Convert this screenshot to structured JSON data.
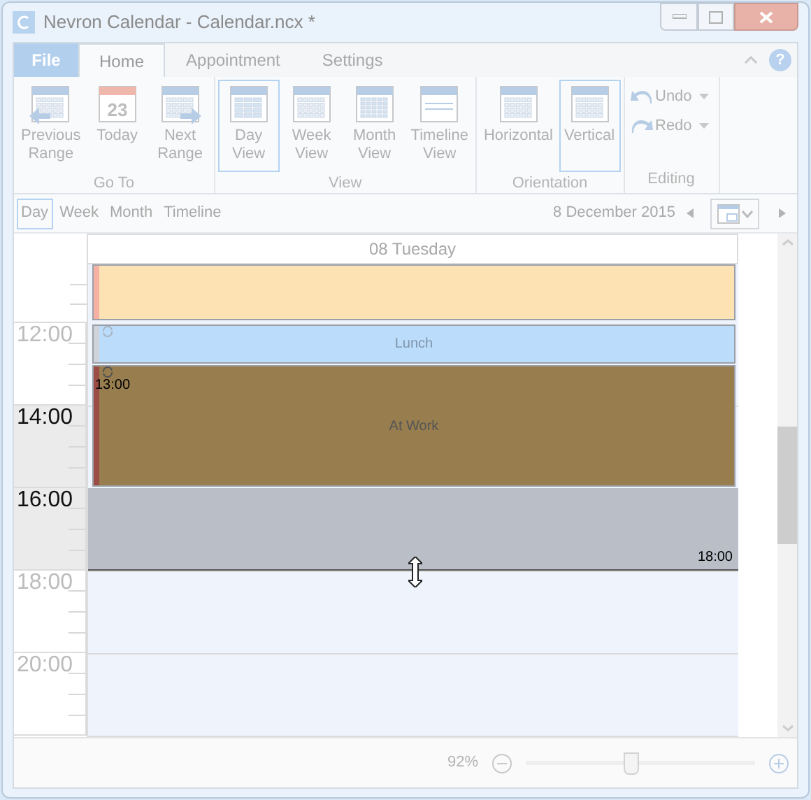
{
  "window": {
    "title": "Nevron Calendar - Calendar.ncx *"
  },
  "ribbon": {
    "file_tab": "File",
    "help": "?",
    "tabs": [
      {
        "label": "Home",
        "selected": true
      },
      {
        "label": "Appointment",
        "selected": false
      },
      {
        "label": "Settings",
        "selected": false
      }
    ],
    "groups": [
      {
        "label": "Go To",
        "buttons": [
          {
            "kind": "previous",
            "lines": [
              "Previous",
              "Range"
            ],
            "selected": false
          },
          {
            "kind": "today",
            "lines": [
              "Today"
            ],
            "day": "23",
            "selected": false
          },
          {
            "kind": "next",
            "lines": [
              "Next",
              "Range"
            ],
            "selected": false
          }
        ]
      },
      {
        "label": "View",
        "buttons": [
          {
            "kind": "day",
            "lines": [
              "Day",
              "View"
            ],
            "selected": true
          },
          {
            "kind": "week",
            "lines": [
              "Week",
              "View"
            ],
            "selected": false
          },
          {
            "kind": "month",
            "lines": [
              "Month",
              "View"
            ],
            "selected": false
          },
          {
            "kind": "timeline",
            "lines": [
              "Timeline",
              "View"
            ],
            "selected": false
          }
        ]
      },
      {
        "label": "Orientation",
        "buttons": [
          {
            "kind": "horizontal",
            "lines": [
              "Horizontal"
            ],
            "selected": false
          },
          {
            "kind": "vertical",
            "lines": [
              "Vertical"
            ],
            "selected": true
          }
        ]
      }
    ],
    "editing": {
      "label": "Editing",
      "buttons": [
        {
          "kind": "undo",
          "label": "Undo"
        },
        {
          "kind": "redo",
          "label": "Redo"
        }
      ]
    }
  },
  "view_bar": {
    "views": [
      {
        "label": "Day",
        "selected": true
      },
      {
        "label": "Week",
        "selected": false
      },
      {
        "label": "Month",
        "selected": false
      },
      {
        "label": "Timeline",
        "selected": false
      }
    ],
    "date": "8 December 2015"
  },
  "calendar": {
    "day_header": "08 Tuesday",
    "hours": [
      {
        "label": "12:00",
        "highlighted": false
      },
      {
        "label": "14:00",
        "highlighted": true
      },
      {
        "label": "16:00",
        "highlighted": true
      },
      {
        "label": "18:00",
        "highlighted": false
      },
      {
        "label": "20:00",
        "highlighted": false
      }
    ],
    "events": [
      {
        "kind": "plain",
        "color": "#fde3b3",
        "stripe": {
          "color": "#f6b0a4"
        }
      },
      {
        "kind": "recurring",
        "color": "#bbdcfb",
        "stripe": {
          "color": "#d0d4da"
        },
        "title": "Lunch"
      },
      {
        "kind": "recurring",
        "color": "#987d4e",
        "stripe": {
          "color": "#9b4d45"
        },
        "title": "At Work",
        "start_label": "13:00"
      },
      {
        "kind": "dragged",
        "color": "#b9bec7",
        "end_label": "18:00"
      }
    ]
  },
  "status_bar": {
    "zoom": "92%",
    "zoom_slider": {
      "level": 0.46
    }
  }
}
